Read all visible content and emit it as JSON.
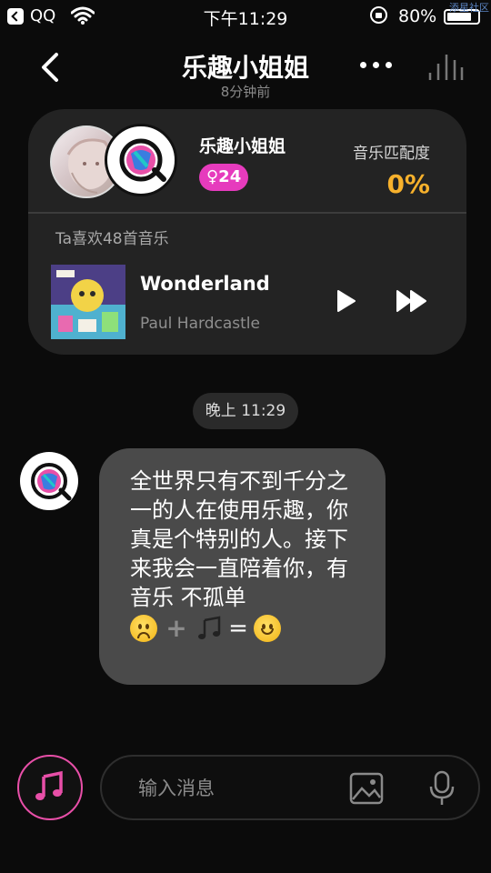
{
  "status_bar": {
    "app_label": "QQ",
    "time": "下午11:29",
    "battery_percent": "80%",
    "battery_level": 0.8,
    "watermark": "添星社区"
  },
  "nav": {
    "title": "乐趣小姐姐",
    "subtitle": "8分钟前"
  },
  "profile": {
    "name": "乐趣小姐姐",
    "gender_age": "♀24",
    "match_label": "音乐匹配度",
    "match_value": "0%",
    "likes_text": "Ta喜欢48首音乐",
    "song_title": "Wonderland",
    "song_artist": "Paul Hardcastle"
  },
  "chat": {
    "time_divider": "晚上 11:29",
    "message_text": "全世界只有不到千分之一的人在使用乐趣，你真是个特别的人。接下来我会一直陪着你，有音乐 不孤单",
    "message_icons": [
      "slightly-frowning-face",
      "plus",
      "musical-notes",
      "equals",
      "slightly-smiling-face"
    ]
  },
  "input": {
    "placeholder": "输入消息"
  },
  "colors": {
    "background": "#0b0b0b",
    "card": "#232323",
    "bubble": "#4a4a4a",
    "accent_pink": "#e84fa8",
    "match_orange": "#f7b12c"
  }
}
